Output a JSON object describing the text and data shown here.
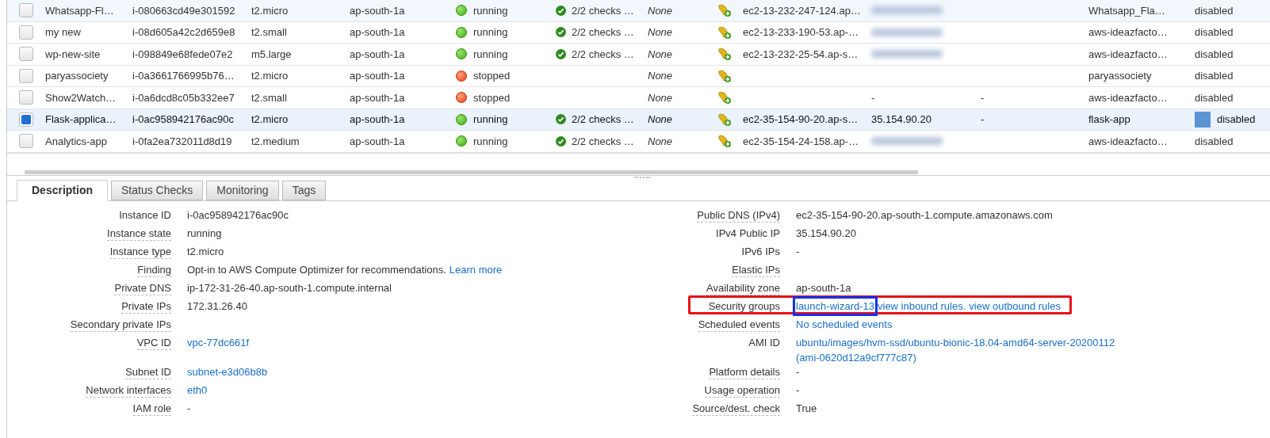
{
  "instances": [
    {
      "name": "Whatsapp-Fl…",
      "instance_id": "i-080663cd49e301592",
      "type": "t2.micro",
      "zone": "ap-south-1a",
      "state": "running",
      "status_checks": "2/2 checks …",
      "alarm": "None",
      "public_dns": "ec2-13-232-247-124.ap…",
      "ip_blurred": true,
      "key": "Whatsapp_Fla…",
      "monitoring": "disabled",
      "selected": false,
      "hovered": true
    },
    {
      "name": "my new",
      "instance_id": "i-08d605a42c2d659e8",
      "type": "t2.small",
      "zone": "ap-south-1a",
      "state": "running",
      "status_checks": "2/2 checks …",
      "alarm": "None",
      "public_dns": "ec2-13-233-190-53.ap-…",
      "ip_blurred": true,
      "key": "aws-ideazfacto…",
      "monitoring": "disabled",
      "selected": false,
      "hovered": false
    },
    {
      "name": "wp-new-site",
      "instance_id": "i-098849e68fede07e2",
      "type": "m5.large",
      "zone": "ap-south-1a",
      "state": "running",
      "status_checks": "2/2 checks …",
      "alarm": "None",
      "public_dns": "ec2-13-232-25-54.ap-s…",
      "ip_blurred": true,
      "key": "aws-ideazfacto…",
      "monitoring": "disabled",
      "selected": false,
      "hovered": false
    },
    {
      "name": "paryassociety",
      "instance_id": "i-0a3661766995b76…",
      "type": "t2.micro",
      "zone": "ap-south-1a",
      "state": "stopped",
      "alarm": "None",
      "ip_blurred": false,
      "key": "paryassociety",
      "monitoring": "disabled",
      "selected": false,
      "hovered": false
    },
    {
      "name": "Show2Watch…",
      "instance_id": "i-0a6dcd8c05b332ee7",
      "type": "t2.small",
      "zone": "ap-south-1a",
      "state": "stopped",
      "alarm": "None",
      "public_ip": "-",
      "ipv6": "-",
      "ip_blurred": false,
      "key": "aws-ideazfacto…",
      "monitoring": "disabled",
      "selected": false,
      "hovered": false
    },
    {
      "name": "Flask-applica…",
      "instance_id": "i-0ac958942176ac90c",
      "type": "t2.micro",
      "zone": "ap-south-1a",
      "state": "running",
      "status_checks": "2/2 checks …",
      "alarm": "None",
      "public_dns": "ec2-35-154-90-20.ap-s…",
      "public_ip": "35.154.90.20",
      "ipv6": "-",
      "ip_blurred": false,
      "key": "flask-app",
      "monitoring": "disabled",
      "selected": true,
      "hovered": false
    },
    {
      "name": "Analytics-app",
      "instance_id": "i-0fa2ea732011d8d19",
      "type": "t2.medium",
      "zone": "ap-south-1a",
      "state": "running",
      "status_checks": "2/2 checks …",
      "alarm": "None",
      "public_dns": "ec2-35-154-24-158.ap-…",
      "ip_blurred": true,
      "key": "aws-ideazfacto…",
      "monitoring": "disabled",
      "selected": false,
      "hovered": false
    }
  ],
  "tabs": [
    {
      "label": "Description",
      "selected": true
    },
    {
      "label": "Status Checks",
      "selected": false
    },
    {
      "label": "Monitoring",
      "selected": false
    },
    {
      "label": "Tags",
      "selected": false
    }
  ],
  "details_left": [
    {
      "label": "Instance ID",
      "underlined": false,
      "value": [
        {
          "text": "i-0ac958942176ac90c",
          "link": false
        }
      ]
    },
    {
      "label": "Instance state",
      "underlined": true,
      "value": [
        {
          "text": "running",
          "link": false
        }
      ]
    },
    {
      "label": "Instance type",
      "underlined": true,
      "value": [
        {
          "text": "t2.micro",
          "link": false
        }
      ]
    },
    {
      "label": "Finding",
      "underlined": true,
      "value": [
        {
          "text": "Opt-in to AWS Compute Optimizer for recommendations.",
          "link": false
        },
        {
          "text": "Learn more",
          "link": true
        }
      ]
    },
    {
      "label": "Private DNS",
      "underlined": true,
      "value": [
        {
          "text": "ip-172-31-26-40.ap-south-1.compute.internal",
          "link": false
        }
      ]
    },
    {
      "label": "Private IPs",
      "underlined": true,
      "value": [
        {
          "text": "172.31.26.40",
          "link": false
        }
      ]
    },
    {
      "label": "Secondary private IPs",
      "underlined": true
    },
    {
      "label": "VPC ID",
      "underlined": true,
      "value": [
        {
          "text": "vpc-77dc661f",
          "link": true
        }
      ]
    },
    {
      "label": "Subnet ID",
      "underlined": true,
      "value": [
        {
          "text": "subnet-e3d06b8b",
          "link": true
        }
      ]
    },
    {
      "label": "Network interfaces",
      "underlined": true,
      "value": [
        {
          "text": "eth0",
          "link": true
        }
      ]
    },
    {
      "label": "IAM role",
      "underlined": true,
      "value": [
        {
          "text": "-",
          "link": false
        }
      ]
    }
  ],
  "details_right": [
    {
      "label": "Public DNS (IPv4)",
      "underlined": true,
      "value": [
        {
          "text": "ec2-35-154-90-20.ap-south-1.compute.amazonaws.com",
          "link": false
        }
      ]
    },
    {
      "label": "IPv4 Public IP",
      "underlined": false,
      "value": [
        {
          "text": "35.154.90.20",
          "link": false
        }
      ]
    },
    {
      "label": "IPv6 IPs",
      "underlined": false,
      "value": [
        {
          "text": "-",
          "link": false
        }
      ]
    },
    {
      "label": "Elastic IPs",
      "underlined": true
    },
    {
      "label": "Availability zone",
      "underlined": true,
      "value": [
        {
          "text": "ap-south-1a",
          "link": false
        }
      ]
    },
    {
      "label": "Security groups",
      "underlined": false,
      "highlighted": true,
      "value": [
        {
          "text": "launch-wizard-13",
          "link": true,
          "outlined": true
        },
        {
          "text": "view inbound rules.",
          "link": true
        },
        {
          "text": "view outbound rules",
          "link": true
        }
      ]
    },
    {
      "label": "Scheduled events",
      "underlined": true,
      "value": [
        {
          "text": "No scheduled events",
          "link": true
        }
      ]
    },
    {
      "label": "AMI ID",
      "underlined": false,
      "value": [
        {
          "text": "ubuntu/images/hvm-ssd/ubuntu-bionic-18.04-amd64-server-20200112",
          "link": true
        },
        {
          "text": "(ami-0620d12a9cf777c87)",
          "link": true,
          "break": true
        }
      ]
    },
    {
      "label": "Platform details",
      "underlined": true,
      "value": [
        {
          "text": "-",
          "link": false
        }
      ]
    },
    {
      "label": "Usage operation",
      "underlined": true,
      "value": [
        {
          "text": "-",
          "link": false
        }
      ]
    },
    {
      "label": "Source/dest. check",
      "underlined": true,
      "value": [
        {
          "text": "True",
          "link": false
        }
      ]
    }
  ]
}
